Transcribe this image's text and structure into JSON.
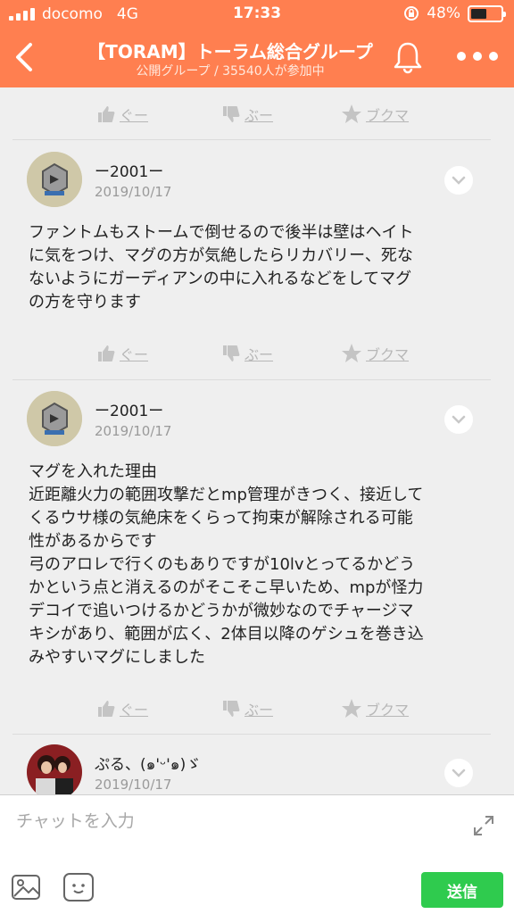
{
  "status_bar": {
    "carrier": "docomo",
    "network": "4G",
    "time": "17:33",
    "battery": "48%",
    "battery_level": 0.48
  },
  "header": {
    "title": "【TORAM】トーラム総合グループ",
    "subtitle": "公開グループ / 35540人が参加中"
  },
  "actions": {
    "like": "ぐー",
    "dislike": "ぶー",
    "bookmark": "ブクマ"
  },
  "posts": [
    {
      "user": "ー2001ー",
      "date": "2019/10/17",
      "text": "ファントムもストームで倒せるので後半は壁はヘイト\nに気をつけ、マグの方が気絶したらリカバリー、死な\nないようにガーディアンの中に入れるなどをしてマグ\nの方を守ります"
    },
    {
      "user": "ー2001ー",
      "date": "2019/10/17",
      "text": "マグを入れた理由\n近距離火力の範囲攻撃だとmp管理がきつく、接近して\nくるウサ様の気絶床をくらって拘束が解除される可能\n性があるからです\n弓のアロレで行くのもありですが10lvとってるかどう\nかという点と消えるのがそこそこ早いため、mpが怪力\nデコイで追いつけるかどうかが微妙なのでチャージマ\nキシがあり、範囲が広く、2体目以降のゲシュを巻き込\nみやすいマグにしました"
    },
    {
      "user": "ぷる、(๑'ᵕ'๑)ゞ",
      "date": "2019/10/17",
      "text": ""
    }
  ],
  "input": {
    "placeholder": "チャットを入力",
    "send_label": "送信"
  },
  "colors": {
    "header": "#ff7f50",
    "send": "#2fcb4e"
  }
}
